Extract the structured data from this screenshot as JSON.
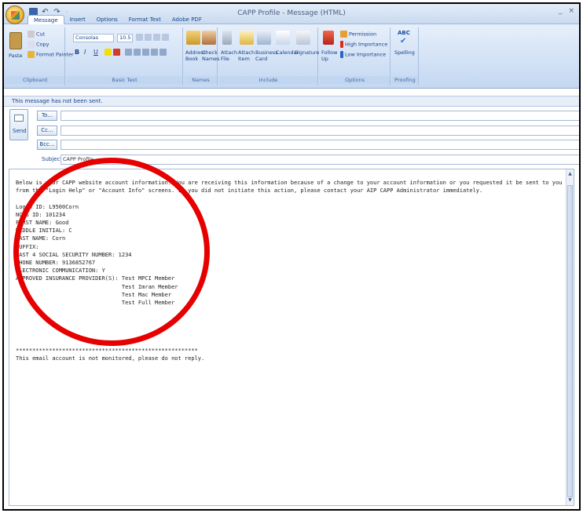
{
  "window": {
    "title": "CAPP Profile - Message (HTML)",
    "controls": [
      "_",
      "×"
    ]
  },
  "quick_access": {
    "undo": "↶",
    "redo": "↷",
    "sep": "·"
  },
  "tabs": [
    {
      "label": "Message",
      "active": true
    },
    {
      "label": "Insert"
    },
    {
      "label": "Options"
    },
    {
      "label": "Format Text"
    },
    {
      "label": "Adobe PDF"
    }
  ],
  "ribbon": {
    "clipboard": {
      "label": "Clipboard",
      "paste": "Paste",
      "cut": "Cut",
      "copy": "Copy",
      "format_painter": "Format Painter"
    },
    "basic_text": {
      "label": "Basic Text",
      "font": "Consolas",
      "size": "10.5",
      "bold": "B",
      "italic": "I",
      "underline": "U"
    },
    "names": {
      "label": "Names",
      "address_book": "Address Book",
      "check_names": "Check Names"
    },
    "include": {
      "label": "Include",
      "attach_file": "Attach File",
      "attach_item": "Attach Item",
      "business_card": "Business Card",
      "calendar": "Calendar",
      "signature": "Signature"
    },
    "options": {
      "label": "Options",
      "follow_up": "Follow Up",
      "permission": "Permission",
      "high_importance": "High Importance",
      "low_importance": "Low Importance"
    },
    "proofing": {
      "label": "Proofing",
      "spelling": "Spelling",
      "abc": "ABC"
    }
  },
  "info_bar": "This message has not been sent.",
  "header": {
    "send": "Send",
    "to": "To...",
    "cc": "Cc...",
    "bcc": "Bcc...",
    "subject_label": "Subject:",
    "subject_value": "CAPP Profile"
  },
  "body": {
    "text": "Below is your CAPP website account information. You are receiving this information because of a change to your account information or you requested it be sent to you from the \"Login Help\" or \"Account Info\" screens. If you did not initiate this action, please contact your AIP CAPP Administrator immediately.\n\nLogin ID: L9500Corn\nNCIS ID: 101234\nFIRST NAME: Good\nMIDDLE INITIAL: C\nLAST NAME: Corn\nSUFFIX:\nLAST 4 SOCIAL SECURITY NUMBER: 1234\nPHONE NUMBER: 9136852767\nELECTRONIC COMMUNICATION: Y\nAPPROVED INSURANCE PROVIDER(S): Test MPCI Member\n                                Test Imran Member\n                                Test Mac Member\n                                Test Full Member\n\n\n\n\n\n*******************************************************\nThis email account is not monitored, please do not reply."
  },
  "colors": {
    "highlight_circle": "#e60000",
    "redaction": "#e00000"
  }
}
